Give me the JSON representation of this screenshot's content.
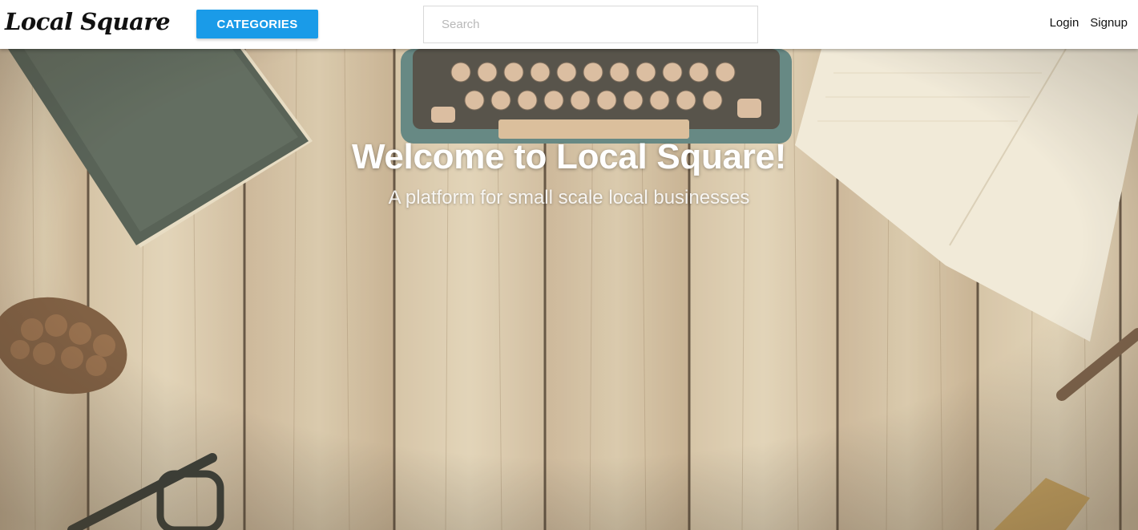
{
  "navbar": {
    "brand": "Local Square",
    "categories_label": "CATEGORIES",
    "search_placeholder": "Search",
    "login_label": "Login",
    "signup_label": "Signup"
  },
  "hero": {
    "title": "Welcome to Local Square!",
    "subtitle": "A platform for small scale local businesses"
  },
  "colors": {
    "accent": "#1a9be8",
    "wood": "#c9b79a"
  }
}
